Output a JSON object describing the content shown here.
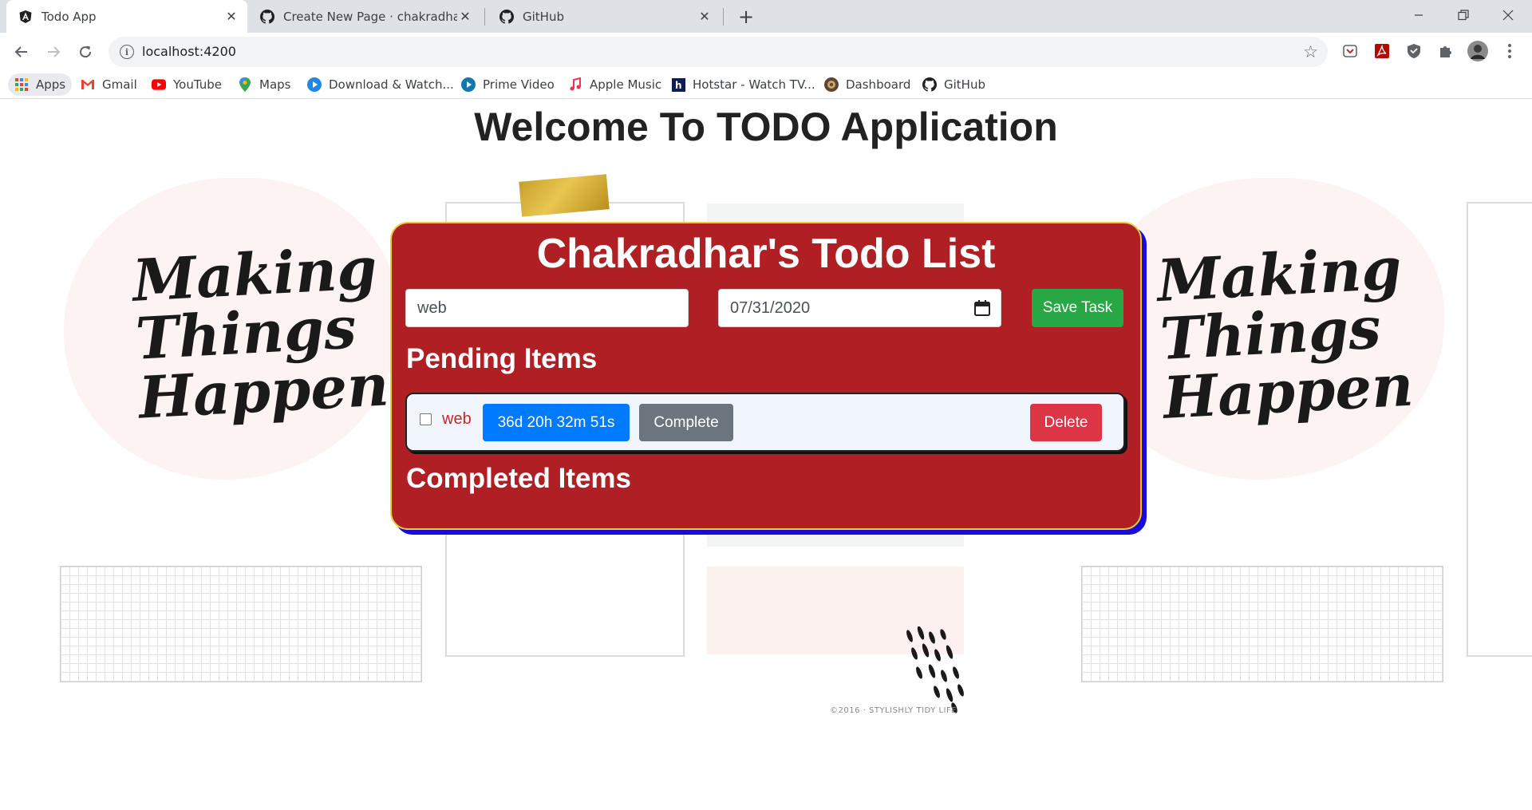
{
  "browser": {
    "tabs": [
      {
        "title": "Todo App",
        "icon": "angular-icon",
        "active": true
      },
      {
        "title": "Create New Page · chakradharchi",
        "icon": "github-icon",
        "active": false
      },
      {
        "title": "GitHub",
        "icon": "github-icon",
        "active": false
      }
    ],
    "url": "localhost:4200",
    "bookmarks": [
      {
        "label": "Apps",
        "icon": "apps-grid-icon"
      },
      {
        "label": "Gmail",
        "icon": "gmail-icon"
      },
      {
        "label": "YouTube",
        "icon": "youtube-icon"
      },
      {
        "label": "Maps",
        "icon": "maps-icon"
      },
      {
        "label": "Download & Watch...",
        "icon": "play-circle-icon"
      },
      {
        "label": "Prime Video",
        "icon": "prime-video-icon"
      },
      {
        "label": "Apple Music",
        "icon": "music-note-icon"
      },
      {
        "label": "Hotstar - Watch TV...",
        "icon": "hotstar-icon"
      },
      {
        "label": "Dashboard",
        "icon": "dashboard-icon"
      },
      {
        "label": "GitHub",
        "icon": "github-icon"
      }
    ]
  },
  "page": {
    "heading": "Welcome To TODO Application",
    "background_text": [
      "Making",
      "Things",
      "Happen"
    ],
    "credit": "©2016 · STYLISHLY TIDY LIFE"
  },
  "todo": {
    "title": "Chakradhar's Todo List",
    "task_input_value": "web",
    "date_input_value": "07/31/2020",
    "save_label": "Save Task",
    "pending_heading": "Pending Items",
    "completed_heading": "Completed Items",
    "pending_items": [
      {
        "name": "web",
        "countdown": "36d 20h 32m 51s",
        "complete_label": "Complete",
        "delete_label": "Delete",
        "checked": false
      }
    ]
  },
  "colors": {
    "card_background": "#b01f24",
    "card_shadow": "#1a0adb",
    "save_button": "#28a745",
    "countdown_button": "#007bff",
    "complete_button": "#6c757d",
    "delete_button": "#dc3545"
  }
}
